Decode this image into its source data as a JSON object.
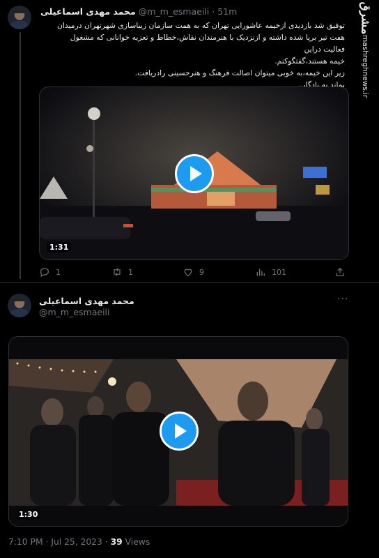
{
  "watermark": {
    "logo_text": "مشرق",
    "url": "mashreghnews.ir"
  },
  "tweet1": {
    "author_name": "محمد مهدی اسماعیلی",
    "handle": "@m_m_esmaeili",
    "separator": "·",
    "time_ago": "51m",
    "text_lines": [
      "توفیق شد بازدیدی ازخیمه عاشورایی تهران که به همت سازمان زیباسازی شهرتهران درمیدان",
      "هفت تیر برپا شده داشته و ازنزدیک با هنرمندان نقاش،خطاط و تعزیه خوانانی که مشغول فعالیت دراین",
      "خیمه هستند،گفتگوکنم.",
      "زیر این خیمه،به خوبی میتوان اصالت فرهنگ و هنرحسینی رادریافت.",
      "بماند به یادگار."
    ],
    "video_duration": "1:31",
    "actions": {
      "replies": "1",
      "retweets": "1",
      "likes": "9",
      "views": "101"
    }
  },
  "tweet2": {
    "author_name": "محمد مهدی اسماعیلی",
    "handle": "@m_m_esmaeili",
    "more": "···",
    "video_duration": "1:30"
  },
  "meta": {
    "time": "7:10 PM",
    "dot": "·",
    "date": "Jul 25, 2023",
    "views_count": "39",
    "views_label": "Views"
  },
  "icons": [
    "reply-icon",
    "retweet-icon",
    "like-icon",
    "views-icon",
    "share-icon",
    "play-icon",
    "more-icon"
  ],
  "colors": {
    "background": "#000000",
    "text": "#e7e9ea",
    "muted": "#71767b",
    "accent": "#1d9bf0",
    "border": "#2f3336"
  }
}
